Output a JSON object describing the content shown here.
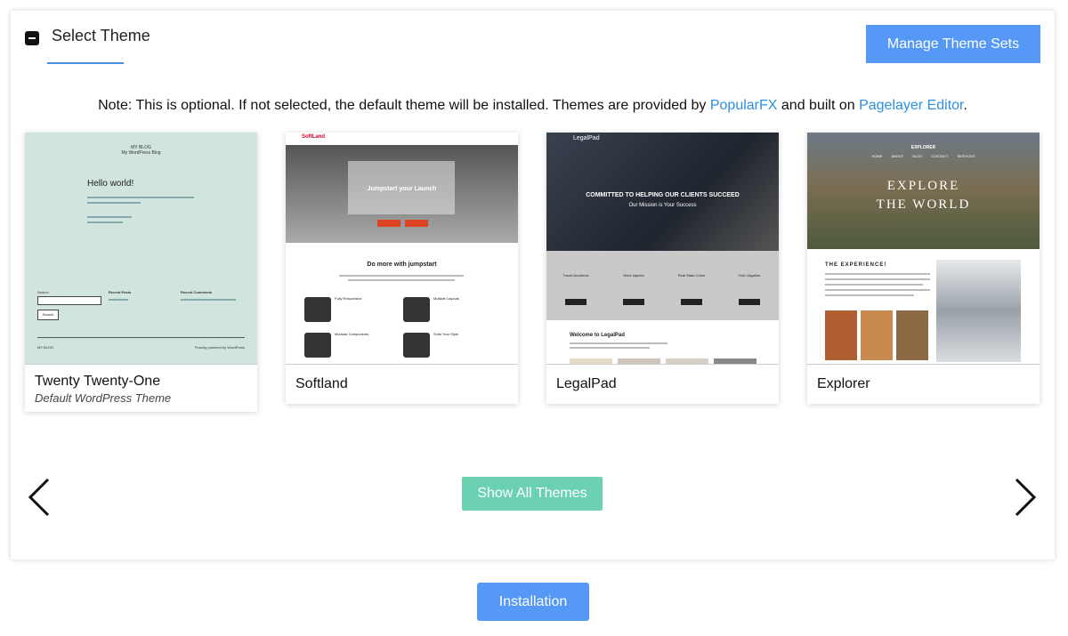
{
  "header": {
    "title": "Select Theme",
    "manage_label": "Manage Theme Sets"
  },
  "note": {
    "prefix": "Note:",
    "text_1": " This is optional. If not selected, the default theme will be installed. Themes are provided by ",
    "link_1": "PopularFX",
    "text_2": " and built on ",
    "link_2": "Pagelayer Editor",
    "text_3": "."
  },
  "themes": [
    {
      "name": "Twenty Twenty-One",
      "subtitle": "Default WordPress Theme",
      "preview": {
        "blog_title": "MY BLOG",
        "blog_tagline": "My WordPress Blog",
        "post_title": "Hello world!",
        "search_label": "Search",
        "search_button": "Search",
        "recent_posts": "Recent Posts",
        "recent_comments": "Recent Comments",
        "footer_left": "MY BLOG",
        "footer_right": "Proudly powered by WordPress"
      }
    },
    {
      "name": "Softland",
      "preview": {
        "logo": "SoftLand",
        "hero_title": "Jumpstart your Launch",
        "section_title": "Do more with jumpstart",
        "features": [
          "Fully Responsive",
          "Multiple Layouts",
          "Modular Components",
          "Suits Your Style"
        ]
      }
    },
    {
      "name": "LegalPad",
      "preview": {
        "logo": "LegalPad",
        "hero_title": "COMMITTED TO HELPING OUR CLIENTS SUCCEED",
        "hero_subtitle": "Our Mission is Your Success",
        "columns": [
          "Travel Accidents",
          "Work Injuries",
          "Real State Crime",
          "Civil Litigation"
        ],
        "welcome": "Welcome to LegalPad"
      }
    },
    {
      "name": "Explorer",
      "preview": {
        "logo": "EXPLORER",
        "hero_title_1": "EXPLORE",
        "hero_title_2": "THE WORLD",
        "nav": [
          "HOME",
          "ABOUT",
          "BLOG",
          "CONTACT",
          "SERVICES"
        ],
        "section_title": "THE EXPERIENCE!"
      }
    }
  ],
  "show_all_label": "Show All Themes",
  "install_label": "Installation",
  "colors": {
    "primary": "#5598f6",
    "success": "#6bd1b2",
    "link": "#2c8fe0"
  }
}
